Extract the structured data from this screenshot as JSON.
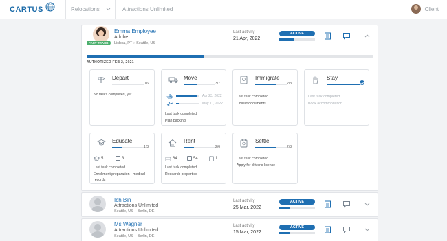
{
  "header": {
    "logo_text": "CARTUS",
    "logo_mark": "®",
    "relocations_label": "Relocations",
    "company_label": "Attractions Unlimited",
    "client_label": "Client"
  },
  "colors": {
    "brand": "#1f6fb2",
    "fast_track": "#4caf6e",
    "active": "#1f6fb2"
  },
  "employees": [
    {
      "name": "Emma Employee",
      "company": "Adobe",
      "route_from": "Lisboa, PT",
      "route_to": "Seattle, US",
      "fast_track_label": "FAST TRACK",
      "last_activity_label": "Last activity",
      "last_activity": "21 Apr, 2022",
      "status": "ACTIVE",
      "progress_fraction": 0.41
    },
    {
      "name": "Ich Bin",
      "company": "Attractions Unlimited",
      "route_from": "Seattle, US",
      "route_to": "Berlin, DE",
      "last_activity_label": "Last activity",
      "last_activity": "25 Mar, 2022",
      "status": "ACTIVE",
      "progress_fraction": 0.3
    },
    {
      "name": "Ms Wagner",
      "company": "Attractions Unlimited",
      "route_from": "Seattle, US",
      "route_to": "Berlin, DE",
      "last_activity_label": "Last activity",
      "last_activity": "15 Mar, 2022",
      "status": "ACTIVE",
      "progress_fraction": 0.3
    }
  ],
  "authorized_label": "AUTHORIZED FEB 2, 2021",
  "overall_progress_fraction": 0.41,
  "services": {
    "depart": {
      "title": "Depart",
      "count": "0/6",
      "progress_fraction": 0,
      "note": "No tasks completed, yet"
    },
    "move": {
      "title": "Move",
      "count": "3/7",
      "progress_fraction": 0.43,
      "sub1_date": "Apr 23, 2022",
      "sub1_fraction": 0.9,
      "sub2_date": "May 11, 2022",
      "sub2_fraction": 0.15,
      "last_label": "Last task completed",
      "last_value": "Plan packing"
    },
    "immigrate": {
      "title": "Immigrate",
      "count": "2/3",
      "progress_fraction": 0.67,
      "last_label": "Last task completed",
      "last_value": "Collect documents"
    },
    "stay": {
      "title": "Stay",
      "progress_fraction": 1,
      "last_label": "Last task completed",
      "last_value": "Book accommodation"
    },
    "educate": {
      "title": "Educate",
      "count": "1/3",
      "progress_fraction": 0.33,
      "stat1": "5",
      "stat2": "3",
      "last_label": "Last task completed",
      "last_value": "Enrollment preparation - medical records"
    },
    "rent": {
      "title": "Rent",
      "count": "2/6",
      "progress_fraction": 0.33,
      "stat1": "64",
      "stat2": "54",
      "stat3": "1",
      "last_label": "Last task completed",
      "last_value": "Research properties"
    },
    "settle": {
      "title": "Settle",
      "count": "2/3",
      "progress_fraction": 0.67,
      "last_label": "Last task completed",
      "last_value": "Apply for driver's license"
    }
  },
  "icons": [
    "globe-icon",
    "chevron-down-icon",
    "document-icon",
    "chat-icon",
    "chevron-up-icon",
    "signpost-icon",
    "truck-icon",
    "passport-icon",
    "hand-icon",
    "graduation-cap-icon",
    "house-icon",
    "clipboard-icon",
    "calendar-icon",
    "ship-icon",
    "plane-icon"
  ]
}
